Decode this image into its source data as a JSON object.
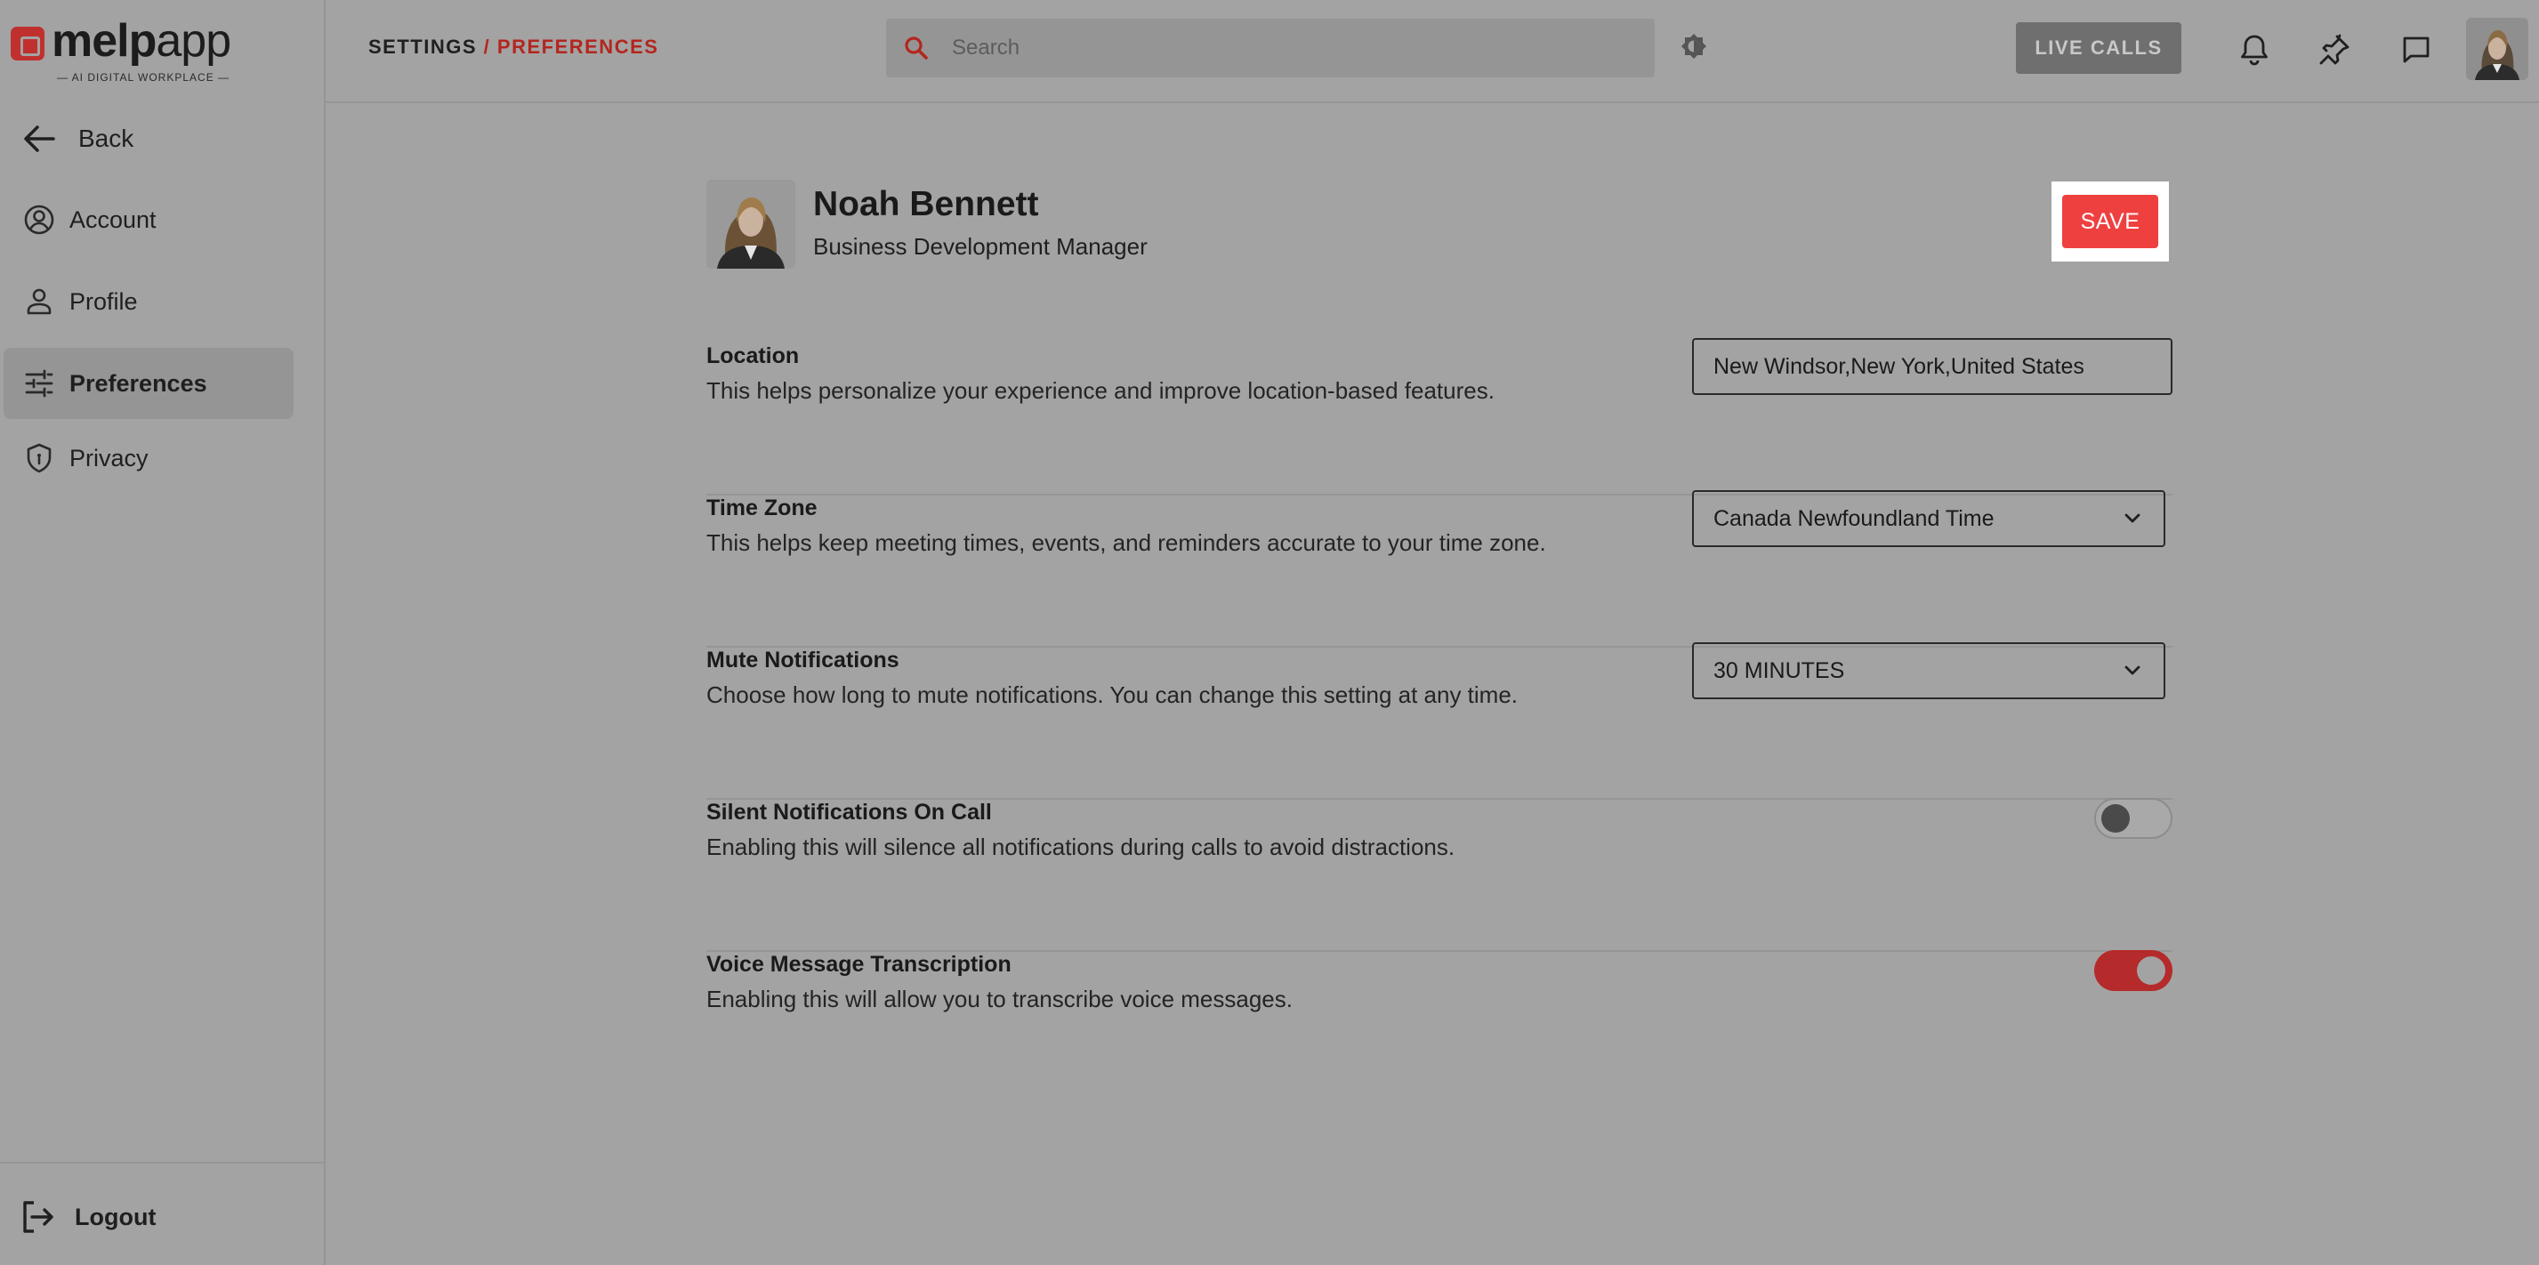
{
  "brand": {
    "name_bold": "melp",
    "name_rest": "app",
    "tagline": "— AI DIGITAL WORKPLACE —"
  },
  "sidebar": {
    "back_label": "Back",
    "items": [
      {
        "label": "Account",
        "icon": "account-circle-icon"
      },
      {
        "label": "Profile",
        "icon": "person-icon"
      },
      {
        "label": "Preferences",
        "icon": "sliders-icon",
        "active": true
      },
      {
        "label": "Privacy",
        "icon": "shield-icon"
      }
    ],
    "logout_label": "Logout"
  },
  "header": {
    "breadcrumb_root": "SETTINGS",
    "breadcrumb_sep": "/",
    "breadcrumb_current": "PREFERENCES",
    "search_placeholder": "Search",
    "live_calls_label": "LIVE CALLS"
  },
  "profile": {
    "name": "Noah Bennett",
    "role": "Business Development Manager",
    "save_label": "SAVE"
  },
  "settings": {
    "location": {
      "title": "Location",
      "description": "This helps personalize your experience and improve location-based features.",
      "value": "New Windsor,New York,United States"
    },
    "time_zone": {
      "title": "Time Zone",
      "description": "This helps keep meeting times, events, and reminders accurate to your time zone.",
      "value": "Canada Newfoundland Time"
    },
    "mute_notifications": {
      "title": "Mute Notifications",
      "description": "Choose how long to mute notifications. You can change this setting at any time.",
      "value": "30 MINUTES"
    },
    "silent_on_call": {
      "title": "Silent Notifications On Call",
      "description": "Enabling this will silence all notifications during calls to avoid distractions.",
      "enabled": false
    },
    "voice_transcription": {
      "title": "Voice Message Transcription",
      "description": "Enabling this will allow you to transcribe voice messages.",
      "enabled": true
    }
  },
  "colors": {
    "accent": "#ef4040",
    "accent_dark": "#b3261e",
    "overlay_bg": "#a3a3a3"
  }
}
